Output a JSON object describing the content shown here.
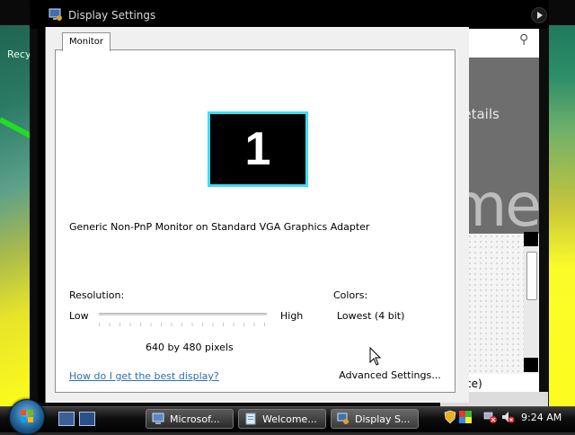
{
  "desktop": {
    "recycle_label": "Recy"
  },
  "background_window": {
    "more_details": "re details",
    "welcome_fragment": "me",
    "tail_text": "ce)"
  },
  "window": {
    "title": "Display Settings",
    "tab_label": "Monitor",
    "monitor_number": "1",
    "adapter_text": "Generic Non-PnP Monitor on Standard VGA Graphics Adapter",
    "resolution_label": "Resolution:",
    "resolution_low": "Low",
    "resolution_high": "High",
    "resolution_value": "640 by 480 pixels",
    "resolution_slider_level": 0,
    "colors_label": "Colors:",
    "colors_value": "Lowest (4 bit)",
    "help_link": "How do I get the best display?",
    "advanced_button": "Advanced Settings..."
  },
  "taskbar": {
    "tasks": [
      {
        "label": "Microsof...",
        "icon": "computer-icon"
      },
      {
        "label": "Welcome...",
        "icon": "document-icon"
      },
      {
        "label": "Display S...",
        "icon": "display-settings-icon"
      }
    ],
    "clock": "9:24 AM"
  },
  "colors": {
    "monitor_border": "#37e0f4",
    "link": "#2e6fae",
    "taskbar": "#000000"
  }
}
